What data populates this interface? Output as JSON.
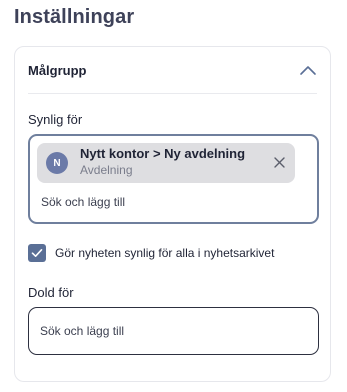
{
  "page": {
    "title": "Inställningar"
  },
  "section": {
    "title": "Målgrupp",
    "icon": "chevron-up-icon",
    "expanded": true
  },
  "visible_for": {
    "label": "Synlig för",
    "chips": [
      {
        "avatar": "N",
        "title": "Nytt kontor > Ny avdelning",
        "subtitle": "Avdelning",
        "remove_icon": "close-icon"
      }
    ],
    "search_placeholder": "Sök och lägg till"
  },
  "archive_option": {
    "label": "Gör nyheten synlig för alla i nyhetsarkivet",
    "checked": true
  },
  "hidden_for": {
    "label": "Dold för",
    "search_placeholder": "Sök och lägg till"
  },
  "colors": {
    "accent": "#5a6f96",
    "avatar": "#6b7aa8",
    "chip_bg": "#dedee1",
    "focus_border": "#6f7f9d"
  }
}
